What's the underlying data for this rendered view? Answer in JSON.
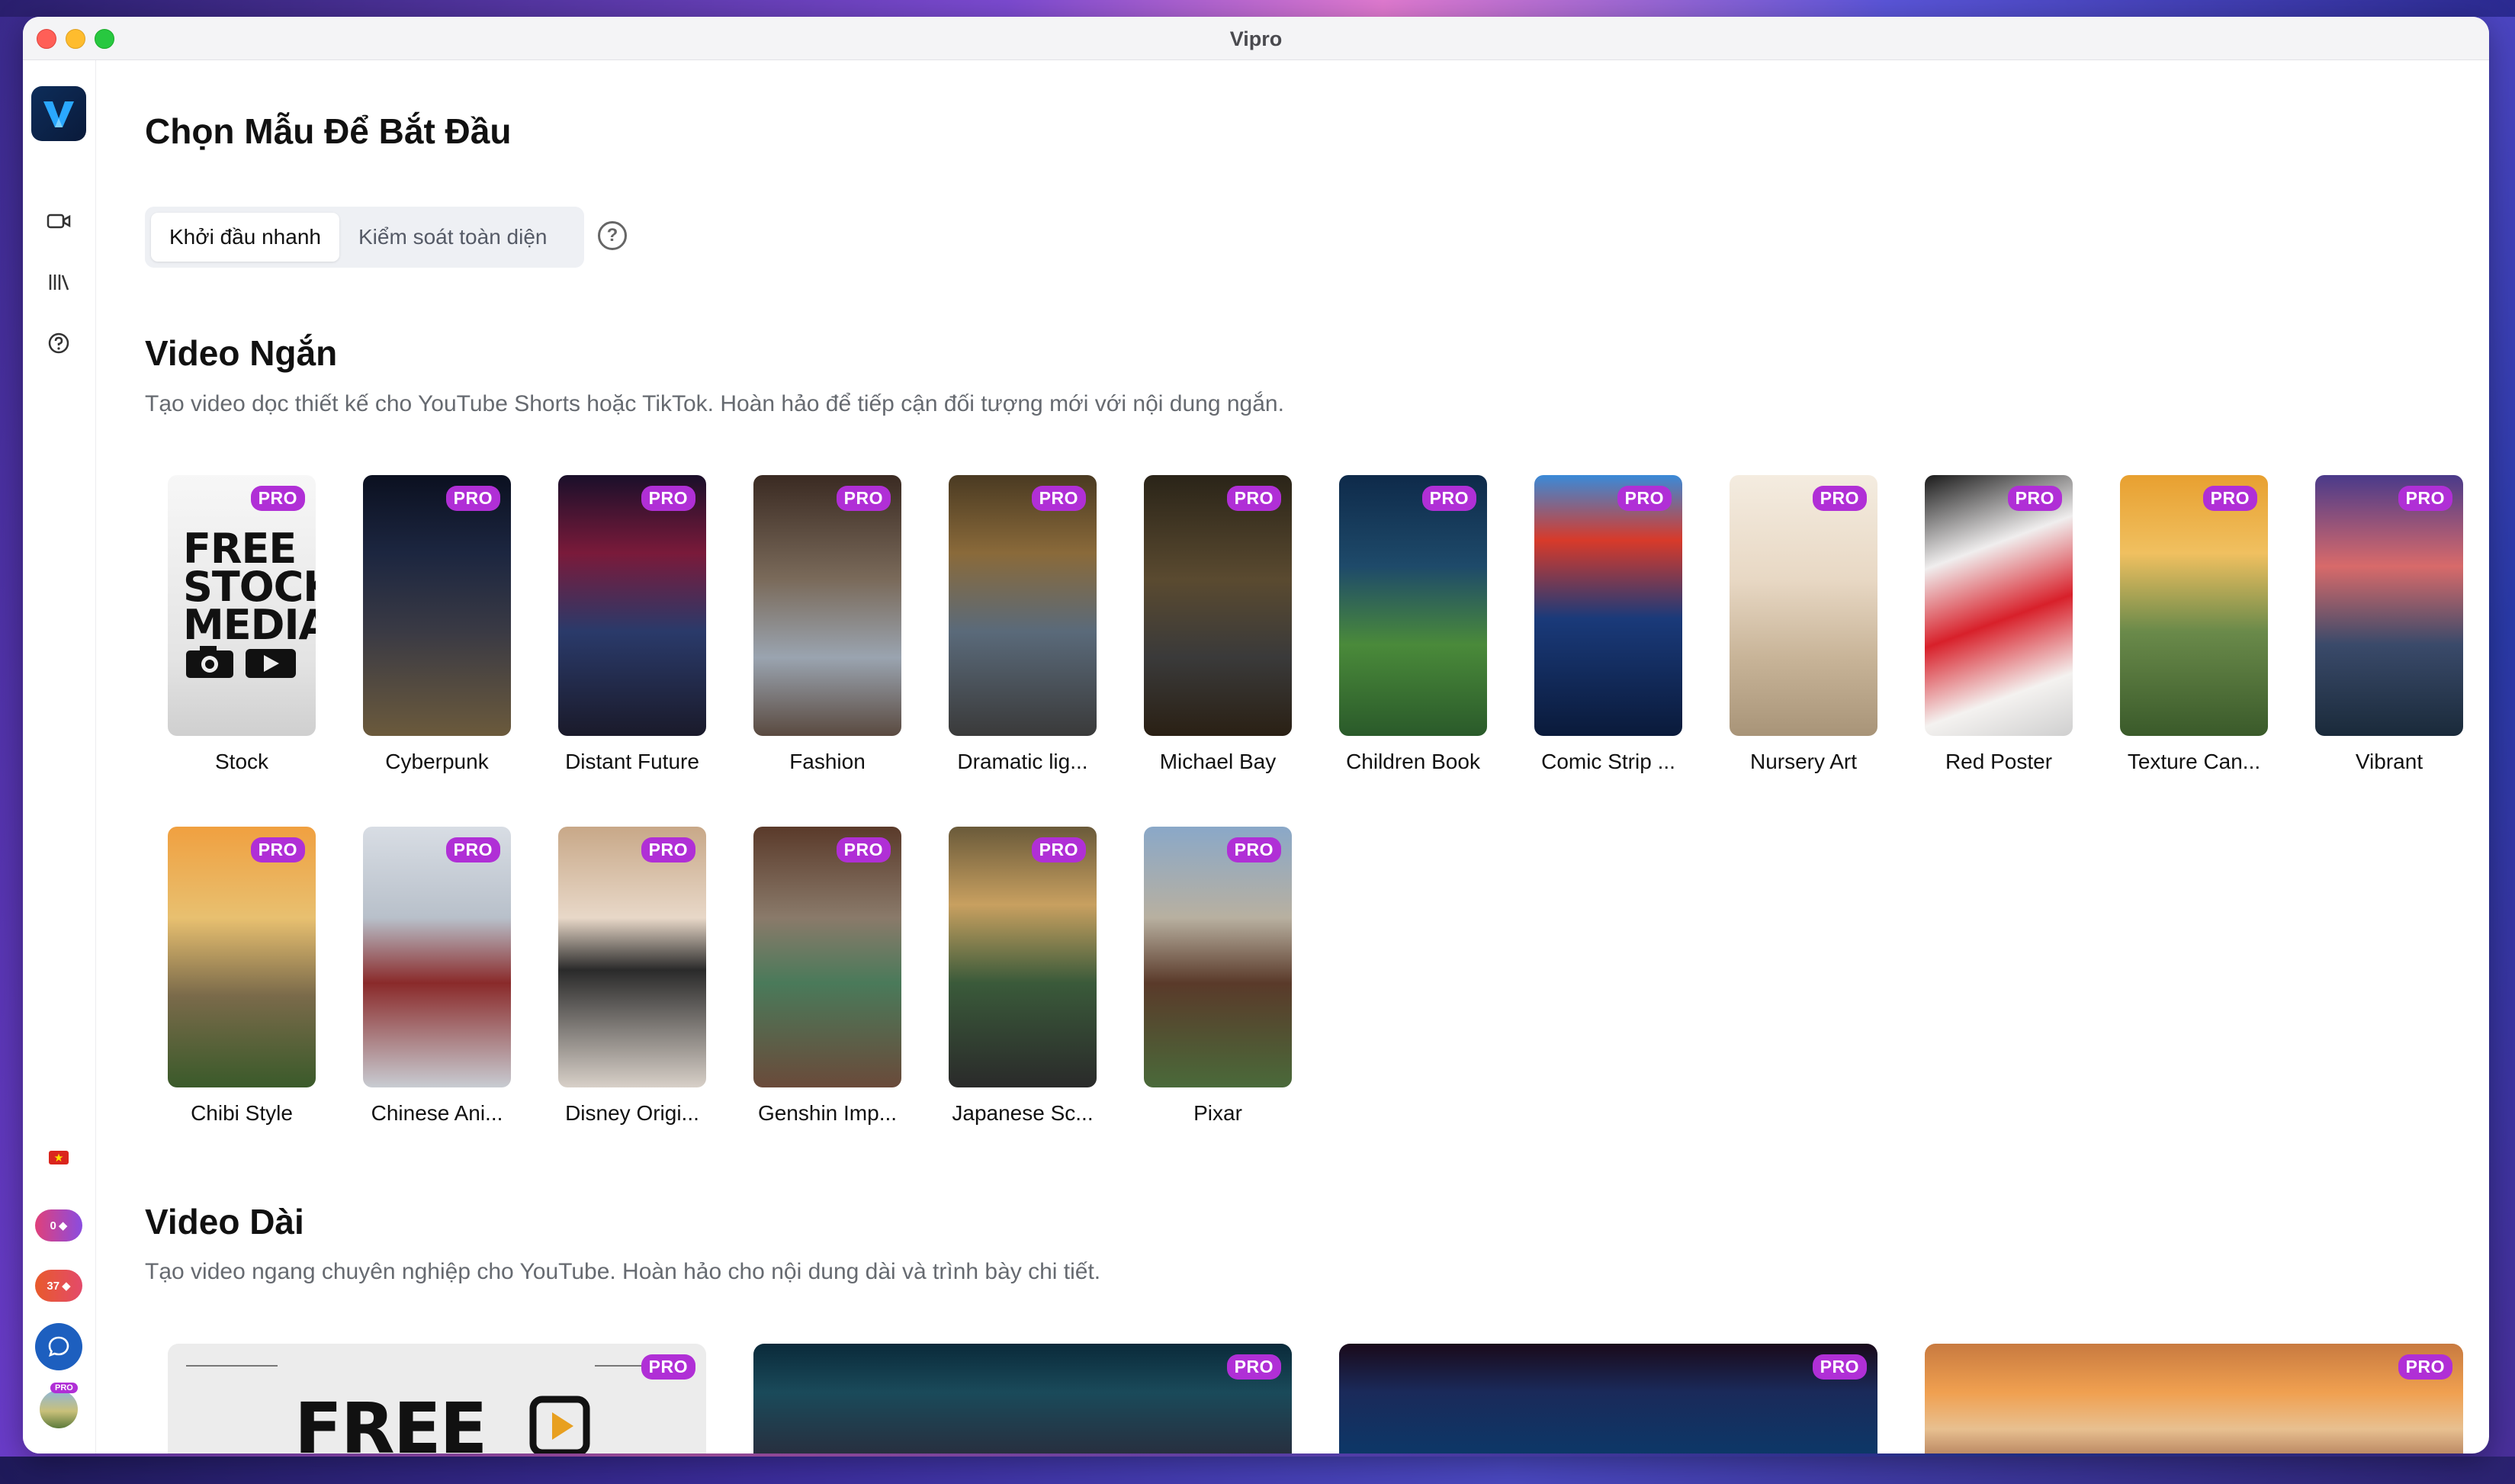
{
  "window": {
    "title": "Vipro"
  },
  "sidebar": {
    "badge_points": "0",
    "badge_credits": "37",
    "avatar_badge": "PRO"
  },
  "page": {
    "title": "Chọn Mẫu Để Bắt Đầu",
    "tabs": [
      {
        "label": "Khởi đầu nhanh",
        "active": true
      },
      {
        "label": "Kiểm soát toàn diện",
        "active": false
      }
    ]
  },
  "short_videos": {
    "title": "Video Ngắn",
    "description": "Tạo video dọc thiết kế cho YouTube Shorts hoặc TikTok. Hoàn hảo để tiếp cận đối tượng mới với nội dung ngắn.",
    "pro_badge": "PRO",
    "stock_overlay": [
      "FREE",
      "STOCK",
      "MEDIA"
    ],
    "templates": [
      {
        "label": "Stock"
      },
      {
        "label": "Cyberpunk"
      },
      {
        "label": "Distant Future"
      },
      {
        "label": "Fashion"
      },
      {
        "label": "Dramatic lig..."
      },
      {
        "label": "Michael Bay"
      },
      {
        "label": "Children Book"
      },
      {
        "label": "Comic Strip ..."
      },
      {
        "label": "Nursery Art"
      },
      {
        "label": "Red Poster"
      },
      {
        "label": "Texture Can..."
      },
      {
        "label": "Vibrant"
      },
      {
        "label": "Chibi Style"
      },
      {
        "label": "Chinese Ani..."
      },
      {
        "label": "Disney Origi..."
      },
      {
        "label": "Genshin Imp..."
      },
      {
        "label": "Japanese Sc..."
      },
      {
        "label": "Pixar"
      }
    ]
  },
  "long_videos": {
    "title": "Video Dài",
    "description": "Tạo video ngang chuyên nghiệp cho YouTube. Hoàn hảo cho nội dung dài và trình bày chi tiết.",
    "stock_overlay": "FREE"
  },
  "colors": {
    "pro_badge": "#b02fd6",
    "accent_blue": "#1d5fbf"
  }
}
